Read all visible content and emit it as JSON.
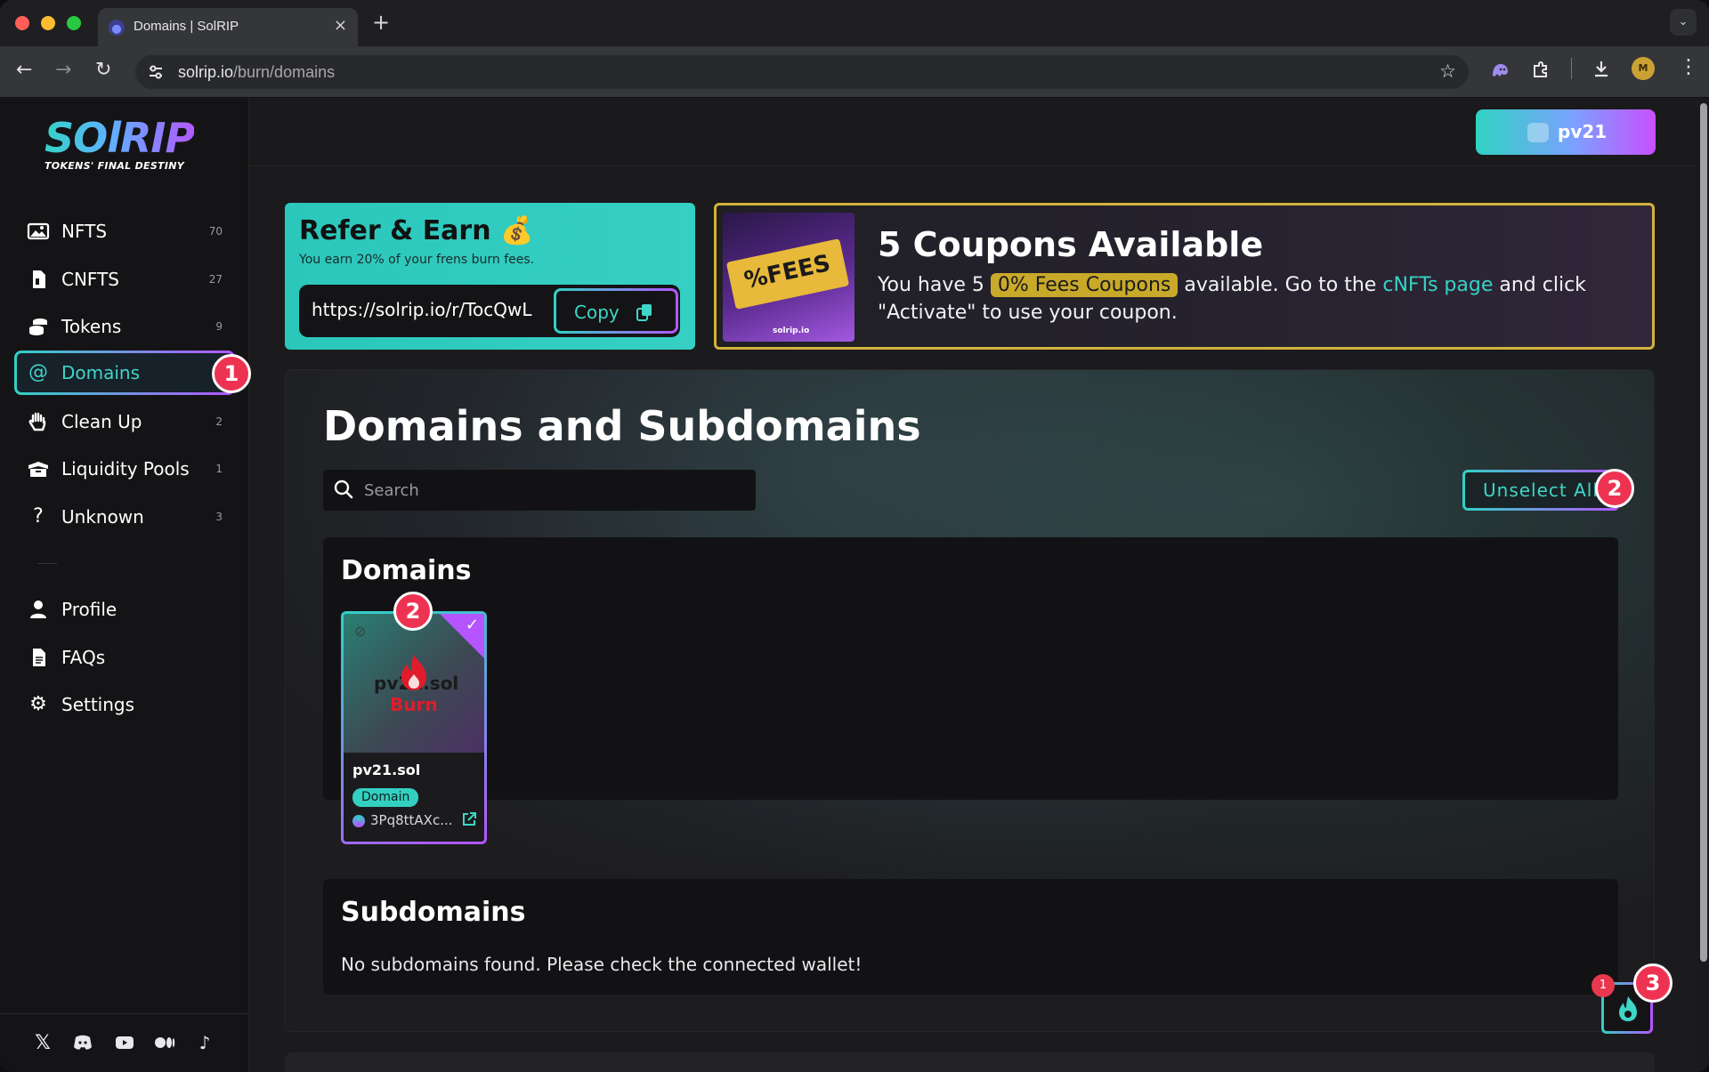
{
  "browser": {
    "tab_title": "Domains | SolRIP",
    "url_host": "solrip.io",
    "url_path": "/burn/domains",
    "tab_close": "×",
    "new_tab": "+",
    "tab_menu": "⌄",
    "extension_avatar": "M"
  },
  "logo": {
    "word": "SOlRIP",
    "tagline": "TOKENS' FINAL DESTINY"
  },
  "sidebar": {
    "items": [
      {
        "label": "NFTS",
        "count": "70",
        "icon": "image-icon"
      },
      {
        "label": "CNFTS",
        "count": "27",
        "icon": "document-icon"
      },
      {
        "label": "Tokens",
        "count": "9",
        "icon": "coins-icon"
      },
      {
        "label": "Domains",
        "count": "",
        "icon": "at-icon",
        "active": true
      },
      {
        "label": "Clean Up",
        "count": "2",
        "icon": "hand-icon"
      },
      {
        "label": "Liquidity Pools",
        "count": "1",
        "icon": "box-icon"
      },
      {
        "label": "Unknown",
        "count": "3",
        "icon": "question-icon"
      }
    ],
    "bottom_items": [
      {
        "label": "Profile",
        "icon": "user-icon"
      },
      {
        "label": "FAQs",
        "icon": "faq-document-icon"
      },
      {
        "label": "Settings",
        "icon": "gear-icon"
      }
    ],
    "social": [
      "x-icon",
      "discord-icon",
      "youtube-icon",
      "medium-icon",
      "tiktok-icon"
    ]
  },
  "wallet": {
    "label": "pv21"
  },
  "refer": {
    "title": "Refer & Earn 💰",
    "subtitle": "You earn 20% of your frens burn fees.",
    "url": "https://solrip.io/r/TocQwL",
    "copy_label": "Copy"
  },
  "coupons": {
    "title": "5 Coupons Available",
    "text_1": "You have 5",
    "chip": "0% Fees Coupons",
    "text_2": "available. Go to the",
    "link": "cNFTs page",
    "text_3": "and click \"Activate\" to use your coupon.",
    "image_text": "%FEES",
    "image_brand": "solrip.io"
  },
  "main": {
    "title": "Domains and Subdomains",
    "search_placeholder": "Search",
    "unselect_label": "Unselect All",
    "domains_title": "Domains",
    "subdomains_title": "Subdomains",
    "subdomains_empty": "No subdomains found. Please check the connected wallet!"
  },
  "domain_card": {
    "name": "pv21.sol",
    "overlay_name": "pv21.sol",
    "burn_label": "Burn",
    "type_chip": "Domain",
    "address": "3Pq8ttAXc...",
    "selected": true
  },
  "burn_fab": {
    "count": "1"
  },
  "step_badges": [
    "1",
    "2",
    "2",
    "3"
  ],
  "colors": {
    "accent_teal": "#30d1c4",
    "accent_purple": "#b455ff",
    "coupon_gold": "#d3b23d",
    "badge_red": "#ee3352"
  }
}
